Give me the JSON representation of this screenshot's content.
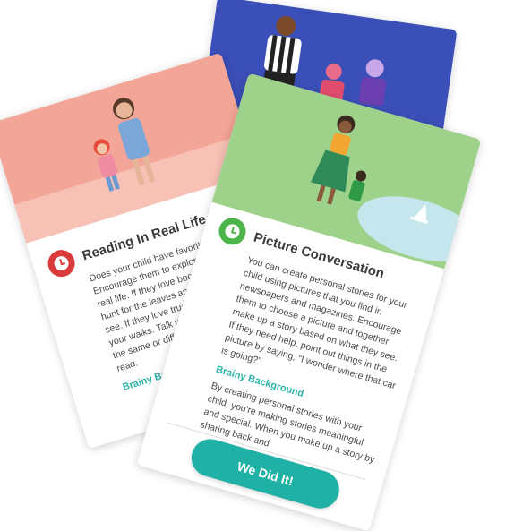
{
  "cards": {
    "reading": {
      "title": "Reading In Real Life",
      "body": "Does your child have favorite books? Encourage them to explore the topics in real life. If they love books about nature, hunt for the leaves and flowers they see. If they love trucks, look for them on your walks. Talk with them about what is the same or different from what they read.",
      "link": "Brainy Background"
    },
    "picture": {
      "title": "Picture Conversation",
      "body": "You can create personal stories for your child using pictures that you find in newspapers and magazines. Encourage them to choose a picture and together make up a story based on what they see. If they need help, point out things in the picture by saying, “I wonder where that car is going?”",
      "brainy_label": "Brainy Background",
      "brainy_text": "By creating personal stories with your child, you're making stories meaningful and special. When you make up a story by sharing back and",
      "button": "We Did It!"
    }
  },
  "colors": {
    "teal": "#1fb1a6",
    "red_icon": "#d93a3a",
    "green_icon": "#4bb54a",
    "blue_card": "#3b4fb8",
    "coral_hero": "#f3a597",
    "green_hero": "#9ed28a"
  }
}
